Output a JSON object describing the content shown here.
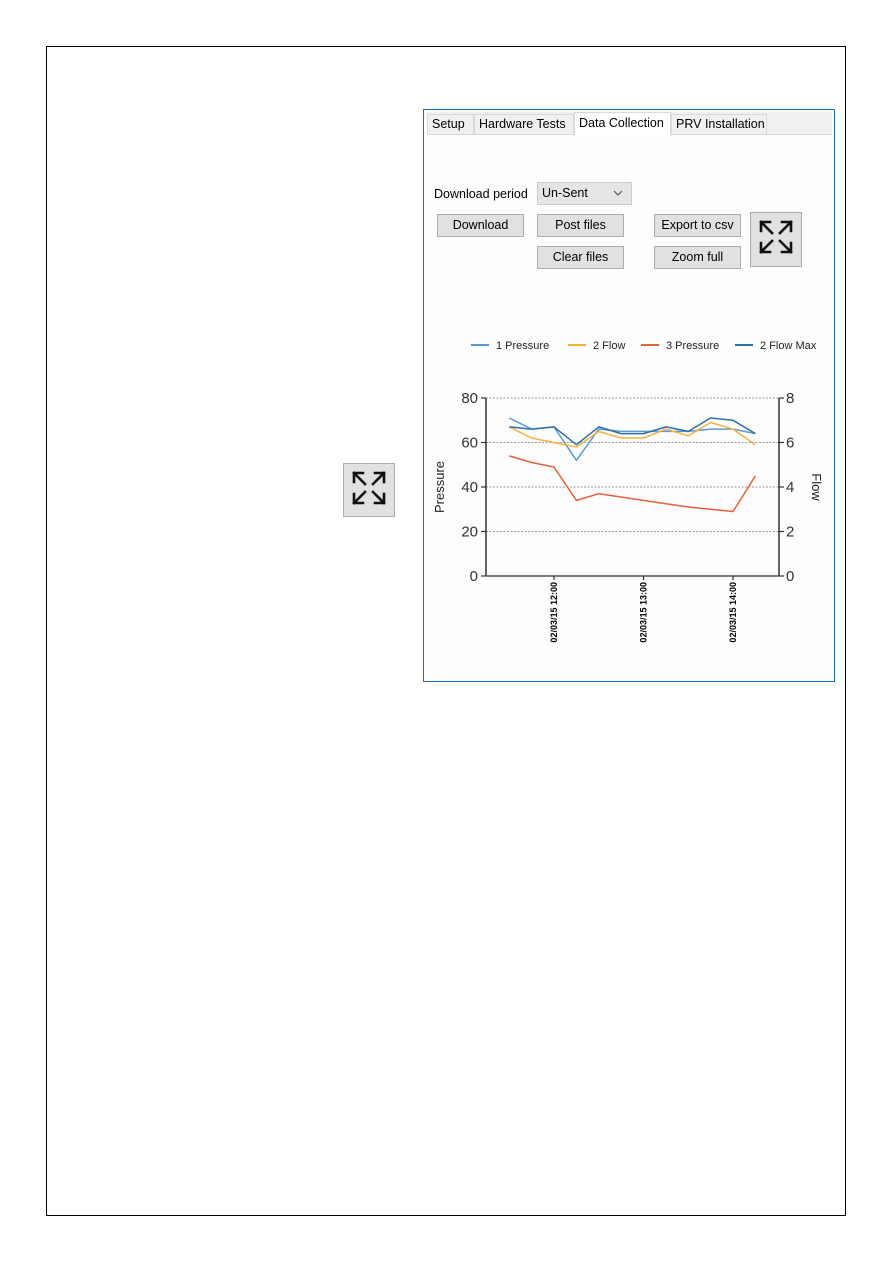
{
  "window": {
    "tabs": [
      {
        "label": "Setup",
        "active": false
      },
      {
        "label": "Hardware Tests",
        "active": false
      },
      {
        "label": "Data Collection",
        "active": true
      },
      {
        "label": "PRV Installation",
        "active": false
      }
    ],
    "download_period_label": "Download period",
    "download_period": {
      "selected": "Un-Sent"
    },
    "buttons": {
      "download": "Download",
      "post_files": "Post files",
      "clear_files": "Clear files",
      "export_csv": "Export to csv",
      "zoom_full": "Zoom full"
    },
    "icons": {
      "expand": "expand-arrows-icon",
      "dropdown": "chevron-down-icon"
    },
    "colors": {
      "window_border": "#1e6fb8",
      "button_bg": "#e1e1e1"
    }
  },
  "chart_data": {
    "type": "line",
    "title": "",
    "xlabel": "",
    "ylabel": "Pressure",
    "y2label": "Flow",
    "ylim": [
      0,
      80
    ],
    "y2lim": [
      0,
      8
    ],
    "yticks": [
      0,
      20,
      40,
      60,
      80
    ],
    "y2ticks": [
      0,
      2,
      4,
      6,
      8
    ],
    "grid": true,
    "legend_position": "top",
    "x": [
      "11:30",
      "11:45",
      "12:00",
      "12:15",
      "12:30",
      "12:45",
      "13:00",
      "13:15",
      "13:30",
      "13:45",
      "14:00",
      "14:15"
    ],
    "xtick_labels": [
      {
        "at": "12:00",
        "label": "02/03/15 12:00"
      },
      {
        "at": "13:00",
        "label": "02/03/15 13:00"
      },
      {
        "at": "14:00",
        "label": "02/03/15 14:00"
      }
    ],
    "series": [
      {
        "name": "1 Pressure",
        "axis": "left",
        "color": "#5b9bd5",
        "values": [
          71,
          66,
          67,
          52,
          66,
          65,
          65,
          65,
          65,
          66,
          66,
          64
        ]
      },
      {
        "name": "2 Flow",
        "axis": "right",
        "color": "#f4b142",
        "values": [
          6.7,
          6.2,
          6.0,
          5.8,
          6.5,
          6.2,
          6.2,
          6.6,
          6.3,
          6.9,
          6.6,
          5.9
        ]
      },
      {
        "name": "3 Pressure",
        "axis": "left",
        "color": "#e8603c",
        "values": [
          54,
          51,
          49,
          34,
          37,
          35.5,
          34,
          32.5,
          31,
          30,
          29,
          45
        ]
      },
      {
        "name": "2 Flow Max",
        "axis": "right",
        "color": "#2e6fa5",
        "values": [
          6.7,
          6.6,
          6.7,
          5.9,
          6.7,
          6.4,
          6.4,
          6.7,
          6.5,
          7.1,
          7.0,
          6.4
        ]
      }
    ]
  }
}
